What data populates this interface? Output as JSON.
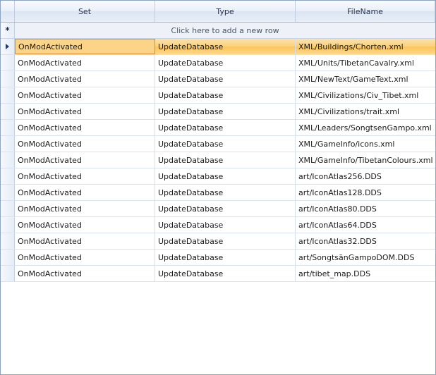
{
  "columns": {
    "set": "Set",
    "type": "Type",
    "filename": "FileName"
  },
  "new_row": {
    "marker": "*",
    "text": "Click here to add a new row"
  },
  "rows": [
    {
      "set": "OnModActivated",
      "type": "UpdateDatabase",
      "filename": "XML/Buildings/Chorten.xml"
    },
    {
      "set": "OnModActivated",
      "type": "UpdateDatabase",
      "filename": "XML/Units/TibetanCavalry.xml"
    },
    {
      "set": "OnModActivated",
      "type": "UpdateDatabase",
      "filename": "XML/NewText/GameText.xml"
    },
    {
      "set": "OnModActivated",
      "type": "UpdateDatabase",
      "filename": "XML/Civilizations/Civ_Tibet.xml"
    },
    {
      "set": "OnModActivated",
      "type": "UpdateDatabase",
      "filename": "XML/Civilizations/trait.xml"
    },
    {
      "set": "OnModActivated",
      "type": "UpdateDatabase",
      "filename": "XML/Leaders/SongtsenGampo.xml"
    },
    {
      "set": "OnModActivated",
      "type": "UpdateDatabase",
      "filename": "XML/GameInfo/icons.xml"
    },
    {
      "set": "OnModActivated",
      "type": "UpdateDatabase",
      "filename": "XML/GameInfo/TibetanColours.xml"
    },
    {
      "set": "OnModActivated",
      "type": "UpdateDatabase",
      "filename": "art/IconAtlas256.DDS"
    },
    {
      "set": "OnModActivated",
      "type": "UpdateDatabase",
      "filename": "art/IconAtlas128.DDS"
    },
    {
      "set": "OnModActivated",
      "type": "UpdateDatabase",
      "filename": "art/IconAtlas80.DDS"
    },
    {
      "set": "OnModActivated",
      "type": "UpdateDatabase",
      "filename": "art/IconAtlas64.DDS"
    },
    {
      "set": "OnModActivated",
      "type": "UpdateDatabase",
      "filename": "art/IconAtlas32.DDS"
    },
    {
      "set": "OnModActivated",
      "type": "UpdateDatabase",
      "filename": "art/SongtsänGampoDOM.DDS"
    },
    {
      "set": "OnModActivated",
      "type": "UpdateDatabase",
      "filename": "art/tibet_map.DDS"
    }
  ],
  "selected_row": 0,
  "colors": {
    "selection": "#fcd37e",
    "selection_border": "#e28a2b",
    "header": "#e9eff8",
    "grid_border": "#8ea3c2"
  }
}
